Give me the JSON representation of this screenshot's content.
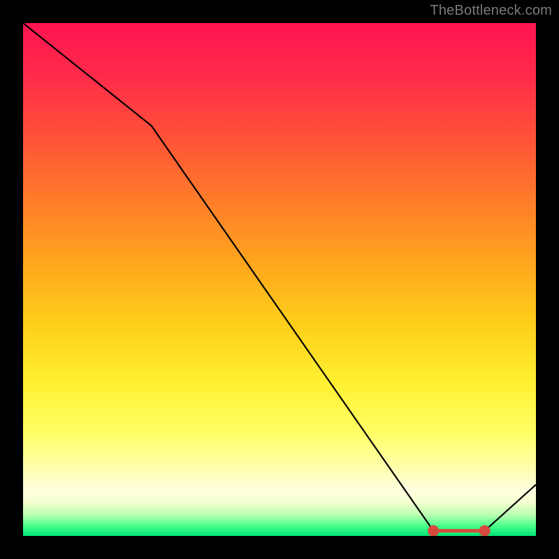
{
  "attribution": "TheBottleneck.com",
  "chart_data": {
    "type": "line",
    "title": "",
    "xlabel": "",
    "ylabel": "",
    "xlim": [
      0,
      100
    ],
    "ylim": [
      0,
      100
    ],
    "x": [
      0,
      25,
      80,
      90,
      100
    ],
    "values": [
      100,
      80,
      1,
      1,
      10
    ],
    "flat_region": {
      "x_start": 80,
      "x_end": 90,
      "y": 1
    },
    "gradient_stops": [
      {
        "pos": 0.0,
        "color": "#ff1450"
      },
      {
        "pos": 0.5,
        "color": "#ffcc19"
      },
      {
        "pos": 0.85,
        "color": "#ffff80"
      },
      {
        "pos": 1.0,
        "color": "#00e676"
      }
    ]
  }
}
